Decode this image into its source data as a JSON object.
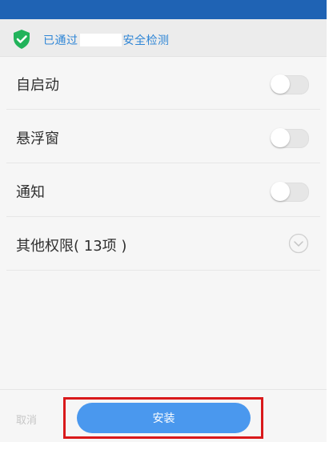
{
  "safety": {
    "prefix": "已通过",
    "suffix": "安全检测",
    "icon": "shield-check-icon",
    "color": "#2f86d6"
  },
  "permissions": [
    {
      "label": "自启动",
      "control": "toggle",
      "state": "off"
    },
    {
      "label": "悬浮窗",
      "control": "toggle",
      "state": "off"
    },
    {
      "label": "通知",
      "control": "toggle",
      "state": "off"
    },
    {
      "label": "其他权限( 13项 )",
      "control": "expand",
      "icon": "chevron-down-circle-icon"
    }
  ],
  "actions": {
    "cancel_label": "取消",
    "install_label": "安装",
    "install_color": "#4a98ee",
    "highlight_color": "#d9191b"
  },
  "header_color": "#1f63b4"
}
